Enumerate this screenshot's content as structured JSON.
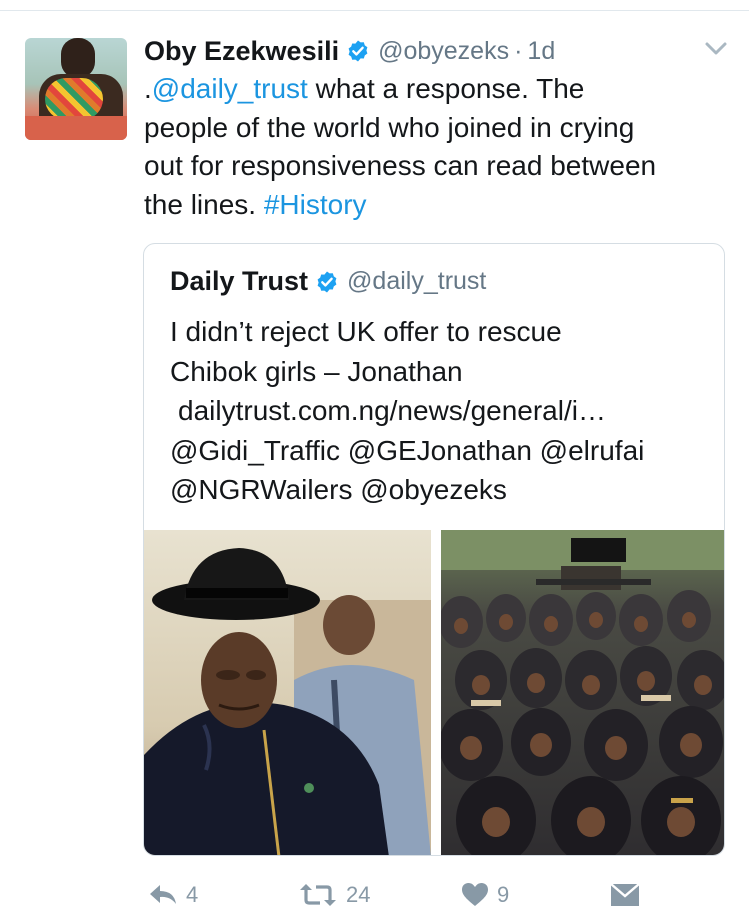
{
  "tweet": {
    "author_name": "Oby Ezekwesili",
    "author_handle": "@obyezeks",
    "separator": "·",
    "time": "1d",
    "text_prefix": ".",
    "mention": "@daily_trust",
    "text_line1_rest": " what a response. The",
    "text_line2": "people of the world who joined in crying",
    "text_line3": "out for responsiveness can read between",
    "text_line4_lead": "the lines. ",
    "hashtag": "#History"
  },
  "quoted": {
    "author_name": "Daily Trust",
    "author_handle": "@daily_trust",
    "line1": "I didn’t reject UK offer to rescue",
    "line2": "Chibok girls – Jonathan",
    "url": "dailytrust.com.ng/news/general/i…",
    "mentions1": "@Gidi_Traffic @GEJonathan @elrufai",
    "mentions2": "@NGRWailers @obyezeks"
  },
  "actions": {
    "reply_count": "4",
    "retweet_count": "24",
    "like_count": "9"
  },
  "icons": {
    "verified": "verified-badge-icon",
    "caret": "chevron-down-icon",
    "reply": "reply-icon",
    "retweet": "retweet-icon",
    "like": "heart-icon",
    "dm": "envelope-icon"
  },
  "colors": {
    "link": "#1b95e0",
    "secondary_text": "#657786",
    "action_icon": "#8899a6",
    "verified": "#1da1f2"
  }
}
